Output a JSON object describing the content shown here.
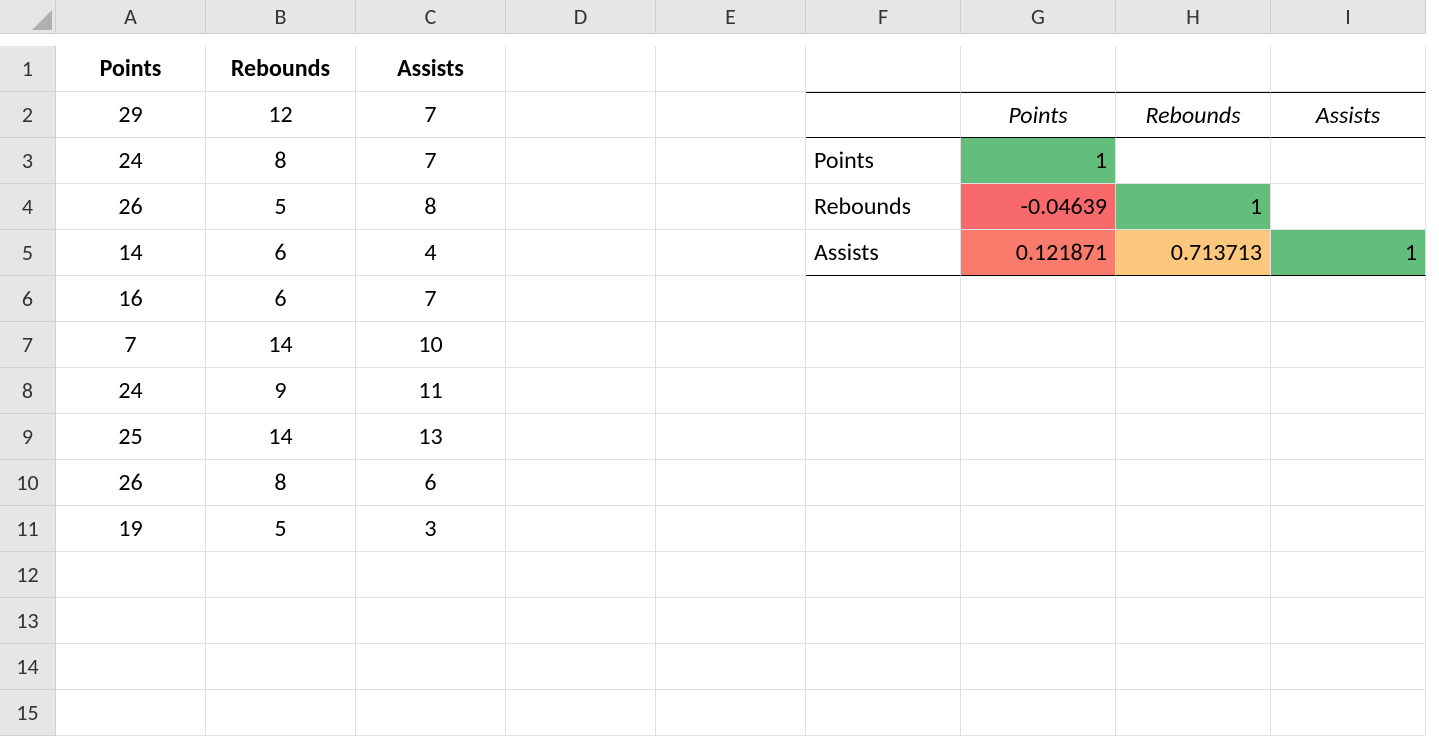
{
  "columns": [
    "A",
    "B",
    "C",
    "D",
    "E",
    "F",
    "G",
    "H",
    "I"
  ],
  "row_labels": [
    "1",
    "2",
    "3",
    "4",
    "5",
    "6",
    "7",
    "8",
    "9",
    "10",
    "11",
    "12",
    "13",
    "14",
    "15"
  ],
  "data": {
    "headers": {
      "A": "Points",
      "B": "Rebounds",
      "C": "Assists"
    },
    "rows": [
      {
        "A": "29",
        "B": "12",
        "C": "7"
      },
      {
        "A": "24",
        "B": "8",
        "C": "7"
      },
      {
        "A": "26",
        "B": "5",
        "C": "8"
      },
      {
        "A": "14",
        "B": "6",
        "C": "4"
      },
      {
        "A": "16",
        "B": "6",
        "C": "7"
      },
      {
        "A": "7",
        "B": "14",
        "C": "10"
      },
      {
        "A": "24",
        "B": "9",
        "C": "11"
      },
      {
        "A": "25",
        "B": "14",
        "C": "13"
      },
      {
        "A": "26",
        "B": "8",
        "C": "6"
      },
      {
        "A": "19",
        "B": "5",
        "C": "3"
      }
    ]
  },
  "correlation_table": {
    "col_headers": {
      "G": "Points",
      "H": "Rebounds",
      "I": "Assists"
    },
    "rows": [
      {
        "label": "Points",
        "G": "1",
        "H": "",
        "I": ""
      },
      {
        "label": "Rebounds",
        "G": "-0.04639",
        "H": "1",
        "I": ""
      },
      {
        "label": "Assists",
        "G": "0.121871",
        "H": "0.713713",
        "I": "1"
      }
    ]
  },
  "cf_colors": {
    "green": "#63be7b",
    "red": "#f8696b",
    "red2": "#fa7a6c",
    "amber": "#fdc77d"
  },
  "chart_data": {
    "type": "table",
    "title": "Correlation matrix with conditional formatting",
    "variables": [
      "Points",
      "Rebounds",
      "Assists"
    ],
    "matrix": [
      [
        1,
        null,
        null
      ],
      [
        -0.04639,
        1,
        null
      ],
      [
        0.121871,
        0.713713,
        1
      ]
    ],
    "raw_data": {
      "Points": [
        29,
        24,
        26,
        14,
        16,
        7,
        24,
        25,
        26,
        19
      ],
      "Rebounds": [
        12,
        8,
        5,
        6,
        6,
        14,
        9,
        14,
        8,
        5
      ],
      "Assists": [
        7,
        7,
        8,
        4,
        7,
        10,
        11,
        13,
        6,
        3
      ]
    },
    "color_scale": {
      "low": "#f8696b",
      "mid": "#fdc77d",
      "high": "#63be7b",
      "domain": [
        -0.05,
        1
      ]
    }
  }
}
